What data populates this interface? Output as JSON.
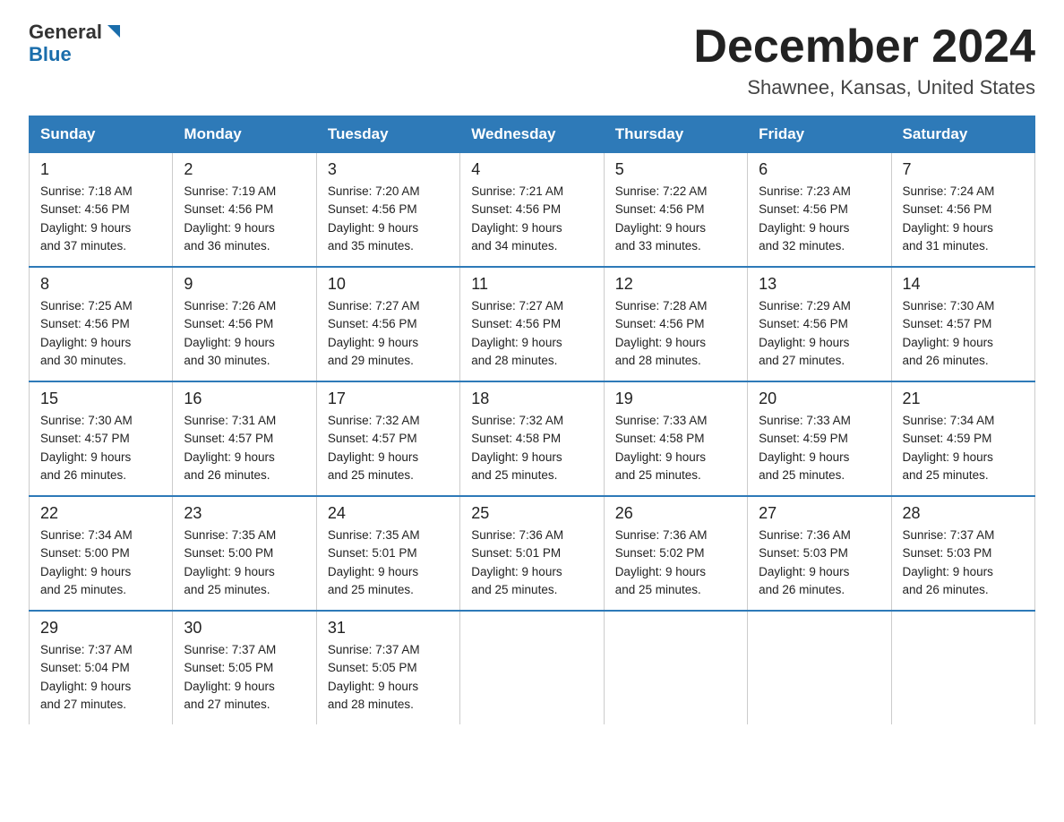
{
  "logo": {
    "line1": "General",
    "triangle": "▶",
    "line2": "Blue"
  },
  "title": "December 2024",
  "subtitle": "Shawnee, Kansas, United States",
  "weekdays": [
    "Sunday",
    "Monday",
    "Tuesday",
    "Wednesday",
    "Thursday",
    "Friday",
    "Saturday"
  ],
  "weeks": [
    [
      {
        "day": "1",
        "sunrise": "7:18 AM",
        "sunset": "4:56 PM",
        "daylight": "9 hours and 37 minutes."
      },
      {
        "day": "2",
        "sunrise": "7:19 AM",
        "sunset": "4:56 PM",
        "daylight": "9 hours and 36 minutes."
      },
      {
        "day": "3",
        "sunrise": "7:20 AM",
        "sunset": "4:56 PM",
        "daylight": "9 hours and 35 minutes."
      },
      {
        "day": "4",
        "sunrise": "7:21 AM",
        "sunset": "4:56 PM",
        "daylight": "9 hours and 34 minutes."
      },
      {
        "day": "5",
        "sunrise": "7:22 AM",
        "sunset": "4:56 PM",
        "daylight": "9 hours and 33 minutes."
      },
      {
        "day": "6",
        "sunrise": "7:23 AM",
        "sunset": "4:56 PM",
        "daylight": "9 hours and 32 minutes."
      },
      {
        "day": "7",
        "sunrise": "7:24 AM",
        "sunset": "4:56 PM",
        "daylight": "9 hours and 31 minutes."
      }
    ],
    [
      {
        "day": "8",
        "sunrise": "7:25 AM",
        "sunset": "4:56 PM",
        "daylight": "9 hours and 30 minutes."
      },
      {
        "day": "9",
        "sunrise": "7:26 AM",
        "sunset": "4:56 PM",
        "daylight": "9 hours and 30 minutes."
      },
      {
        "day": "10",
        "sunrise": "7:27 AM",
        "sunset": "4:56 PM",
        "daylight": "9 hours and 29 minutes."
      },
      {
        "day": "11",
        "sunrise": "7:27 AM",
        "sunset": "4:56 PM",
        "daylight": "9 hours and 28 minutes."
      },
      {
        "day": "12",
        "sunrise": "7:28 AM",
        "sunset": "4:56 PM",
        "daylight": "9 hours and 28 minutes."
      },
      {
        "day": "13",
        "sunrise": "7:29 AM",
        "sunset": "4:56 PM",
        "daylight": "9 hours and 27 minutes."
      },
      {
        "day": "14",
        "sunrise": "7:30 AM",
        "sunset": "4:57 PM",
        "daylight": "9 hours and 26 minutes."
      }
    ],
    [
      {
        "day": "15",
        "sunrise": "7:30 AM",
        "sunset": "4:57 PM",
        "daylight": "9 hours and 26 minutes."
      },
      {
        "day": "16",
        "sunrise": "7:31 AM",
        "sunset": "4:57 PM",
        "daylight": "9 hours and 26 minutes."
      },
      {
        "day": "17",
        "sunrise": "7:32 AM",
        "sunset": "4:57 PM",
        "daylight": "9 hours and 25 minutes."
      },
      {
        "day": "18",
        "sunrise": "7:32 AM",
        "sunset": "4:58 PM",
        "daylight": "9 hours and 25 minutes."
      },
      {
        "day": "19",
        "sunrise": "7:33 AM",
        "sunset": "4:58 PM",
        "daylight": "9 hours and 25 minutes."
      },
      {
        "day": "20",
        "sunrise": "7:33 AM",
        "sunset": "4:59 PM",
        "daylight": "9 hours and 25 minutes."
      },
      {
        "day": "21",
        "sunrise": "7:34 AM",
        "sunset": "4:59 PM",
        "daylight": "9 hours and 25 minutes."
      }
    ],
    [
      {
        "day": "22",
        "sunrise": "7:34 AM",
        "sunset": "5:00 PM",
        "daylight": "9 hours and 25 minutes."
      },
      {
        "day": "23",
        "sunrise": "7:35 AM",
        "sunset": "5:00 PM",
        "daylight": "9 hours and 25 minutes."
      },
      {
        "day": "24",
        "sunrise": "7:35 AM",
        "sunset": "5:01 PM",
        "daylight": "9 hours and 25 minutes."
      },
      {
        "day": "25",
        "sunrise": "7:36 AM",
        "sunset": "5:01 PM",
        "daylight": "9 hours and 25 minutes."
      },
      {
        "day": "26",
        "sunrise": "7:36 AM",
        "sunset": "5:02 PM",
        "daylight": "9 hours and 25 minutes."
      },
      {
        "day": "27",
        "sunrise": "7:36 AM",
        "sunset": "5:03 PM",
        "daylight": "9 hours and 26 minutes."
      },
      {
        "day": "28",
        "sunrise": "7:37 AM",
        "sunset": "5:03 PM",
        "daylight": "9 hours and 26 minutes."
      }
    ],
    [
      {
        "day": "29",
        "sunrise": "7:37 AM",
        "sunset": "5:04 PM",
        "daylight": "9 hours and 27 minutes."
      },
      {
        "day": "30",
        "sunrise": "7:37 AM",
        "sunset": "5:05 PM",
        "daylight": "9 hours and 27 minutes."
      },
      {
        "day": "31",
        "sunrise": "7:37 AM",
        "sunset": "5:05 PM",
        "daylight": "9 hours and 28 minutes."
      },
      null,
      null,
      null,
      null
    ]
  ],
  "labels": {
    "sunrise": "Sunrise:",
    "sunset": "Sunset:",
    "daylight": "Daylight:"
  }
}
